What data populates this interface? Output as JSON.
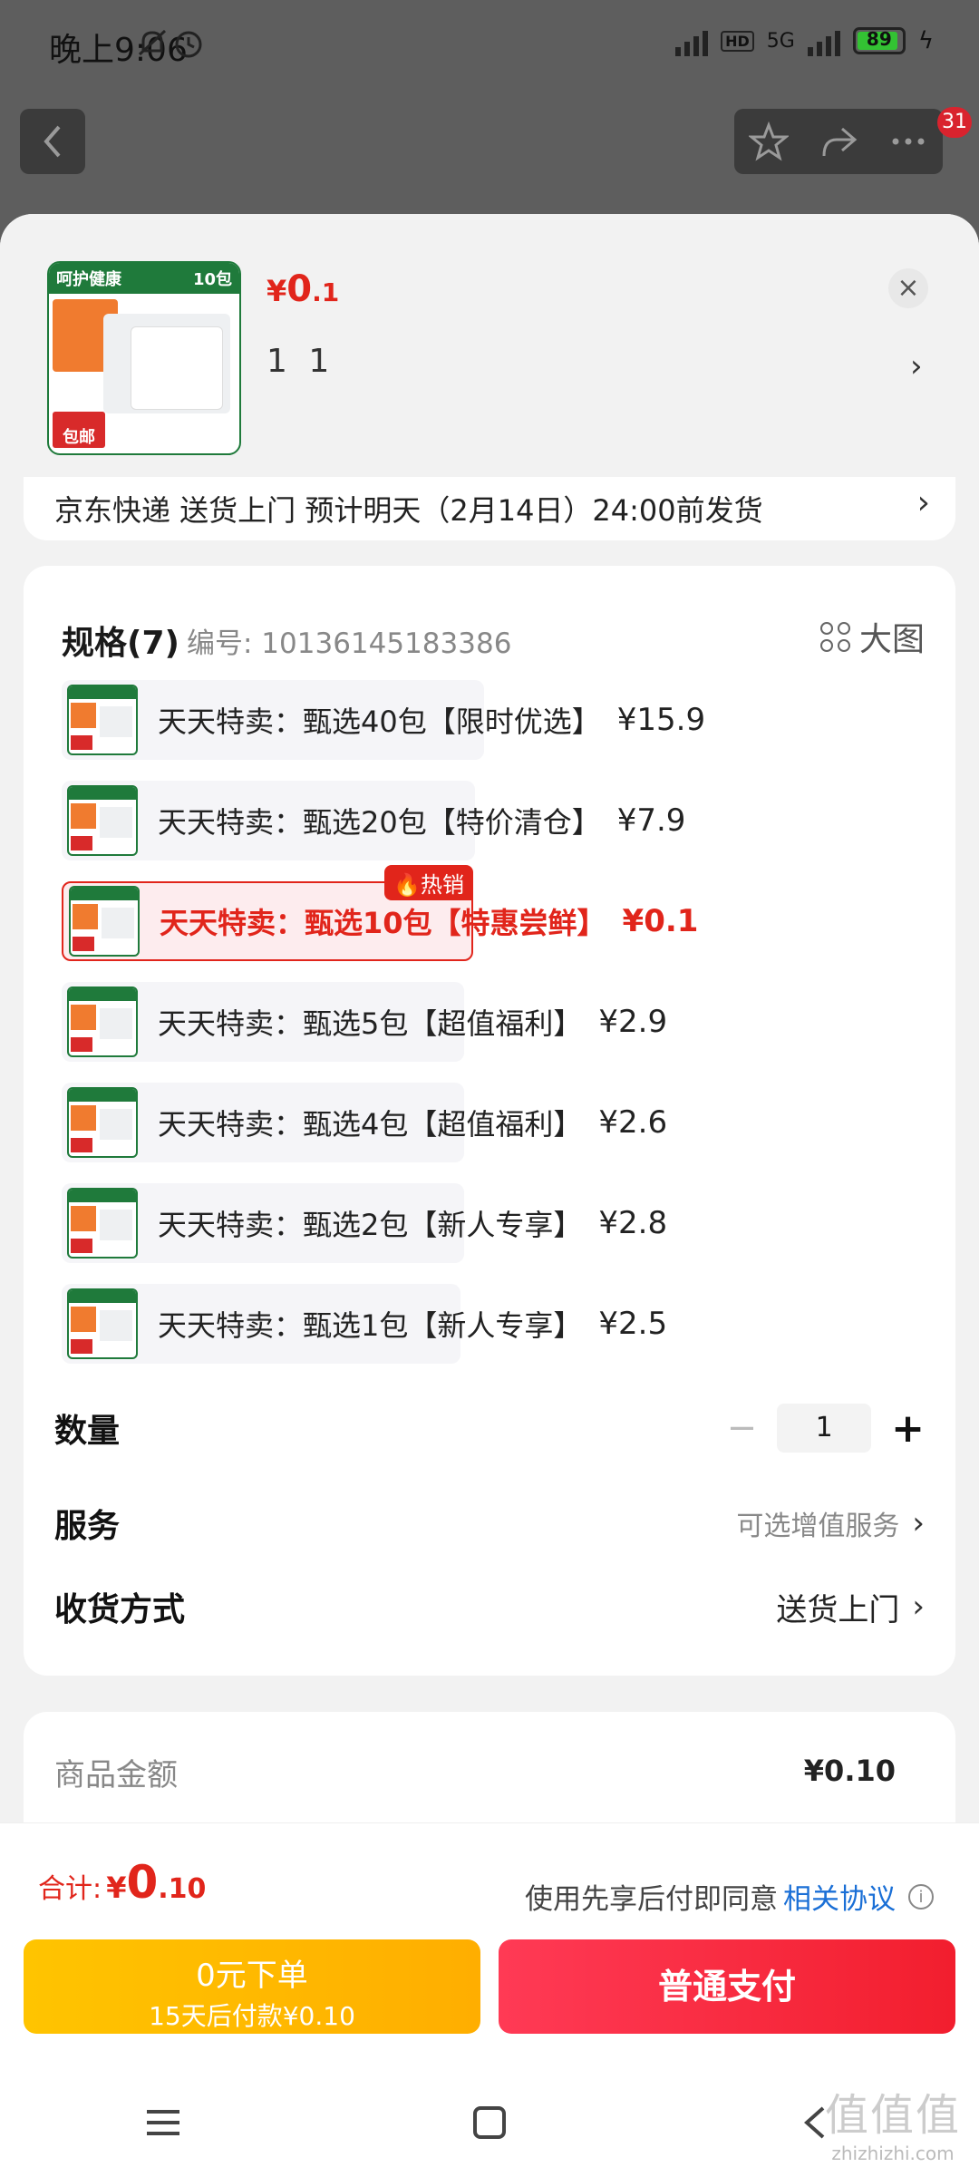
{
  "status": {
    "time": "晚上9:06",
    "network": "5G",
    "battery_level": "89",
    "hd": "HD"
  },
  "nav": {
    "badge_count": "31"
  },
  "product": {
    "thumb_banner": "呵护健康",
    "thumb_count": "10包",
    "thumb_tag": "包邮",
    "price_currency": "¥",
    "price_int": "0",
    "price_dec": ".1",
    "selected_summary": "1 1",
    "shipping": "京东快递 送货上门 预计明天（2月14日）24:00前发货"
  },
  "specs": {
    "title": "规格(7)",
    "code": "编号: 10136145183386",
    "big_view": "大图",
    "hot_label": "热销",
    "options": [
      {
        "label": "天天特卖：甄选40包【限时优选】",
        "price": "¥15.9"
      },
      {
        "label": "天天特卖：甄选20包【特价清仓】",
        "price": "¥7.9"
      },
      {
        "label": "天天特卖：甄选10包【特惠尝鲜】",
        "price": "¥0.1"
      },
      {
        "label": "天天特卖：甄选5包【超值福利】",
        "price": "¥2.9"
      },
      {
        "label": "天天特卖：甄选4包【超值福利】",
        "price": "¥2.6"
      },
      {
        "label": "天天特卖：甄选2包【新人专享】",
        "price": "¥2.8"
      },
      {
        "label": "天天特卖：甄选1包【新人专享】",
        "price": "¥2.5"
      }
    ],
    "selected_index": 2
  },
  "rows": {
    "quantity_label": "数量",
    "quantity_value": "1",
    "service_label": "服务",
    "service_value": "可选增值服务",
    "delivery_label": "收货方式",
    "delivery_value": "送货上门"
  },
  "amount": {
    "label": "商品金额",
    "value": "¥0.10"
  },
  "bottom": {
    "total_label": "合计:",
    "total_currency": "¥",
    "total_int": "0",
    "total_dec": ".10",
    "agree_text": "使用先享后付即同意",
    "agree_link": "相关协议",
    "pay_later_line1": "0元下单",
    "pay_later_line2": "15天后付款¥0.10",
    "pay_button": "普通支付"
  },
  "watermark": {
    "text_big": "值值值",
    "text_small": "zhizhizhi.com"
  },
  "colors": {
    "accent_red": "#e1251b",
    "link_blue": "#1a6fd6",
    "pay_later_yellow": "#ffb800",
    "battery_green": "#33c233"
  }
}
